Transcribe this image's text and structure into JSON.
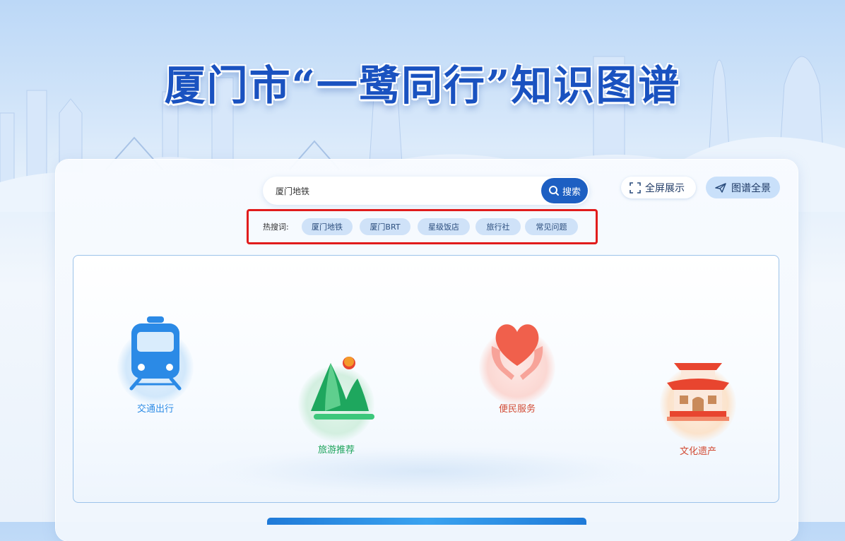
{
  "header": {
    "title": "厦门市“一鹭同行”知识图谱"
  },
  "search": {
    "value": "厦门地铁",
    "button_label": "搜索"
  },
  "toolbar": {
    "fullscreen_label": "全屏展示",
    "graph_overview_label": "图谱全景"
  },
  "hot_search": {
    "label": "热搜词:",
    "tags": [
      "厦门地铁",
      "厦门BRT",
      "星级饭店",
      "旅行社",
      "常见问题"
    ]
  },
  "categories": [
    {
      "label": "交通出行",
      "icon": "train-icon",
      "color": "#2d8ce6"
    },
    {
      "label": "旅游推荐",
      "icon": "mountain-icon",
      "color": "#1ca35a"
    },
    {
      "label": "便民服务",
      "icon": "heart-hands-icon",
      "color": "#e2543f"
    },
    {
      "label": "文化遗产",
      "icon": "pavilion-icon",
      "color": "#e2543f"
    }
  ],
  "colors": {
    "accent": "#1d5fc2",
    "highlight_border": "#e11c1c",
    "tag_bg": "#cfe2f8"
  }
}
